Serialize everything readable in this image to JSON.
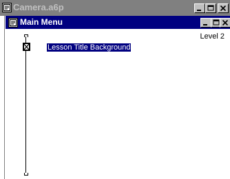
{
  "outer_window": {
    "title": "Camera.a6p",
    "icon": "authorware-file-icon",
    "buttons": [
      "minimize",
      "maximize",
      "close"
    ]
  },
  "inner_window": {
    "title": "Main Menu",
    "icon": "authorware-file-icon",
    "buttons": [
      "minimize",
      "maximize",
      "close"
    ]
  },
  "level": "Level 2",
  "flowline": {
    "items": [
      {
        "label": "Lesson Title Background",
        "icon": "display-icon",
        "selected": true
      }
    ]
  }
}
